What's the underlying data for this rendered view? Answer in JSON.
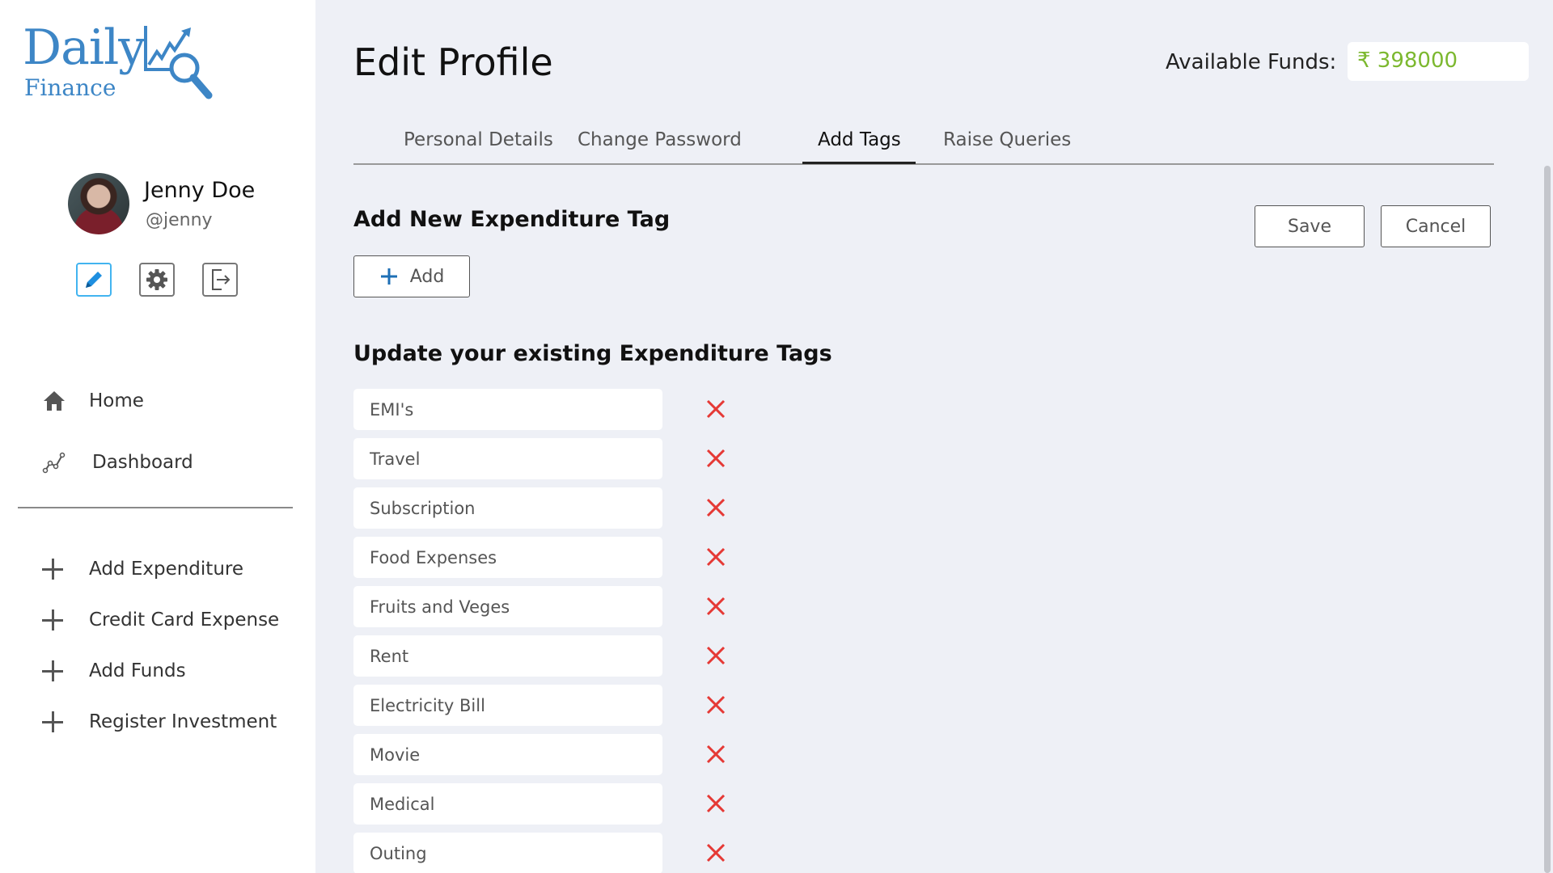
{
  "logo": {
    "line1": "Daily",
    "line2": "Finance"
  },
  "user": {
    "name": "Jenny Doe",
    "handle": "@jenny"
  },
  "nav": [
    {
      "label": "Home",
      "icon": "home-icon"
    },
    {
      "label": "Dashboard",
      "icon": "chart-line-icon"
    }
  ],
  "quick_actions": [
    {
      "label": "Add Expenditure"
    },
    {
      "label": "Credit Card Expense"
    },
    {
      "label": "Add Funds"
    },
    {
      "label": "Register Investment"
    }
  ],
  "header": {
    "title": "Edit Profile",
    "funds_label": "Available Funds:",
    "funds_value": "₹ 398000"
  },
  "tabs": [
    {
      "label": "Personal Details"
    },
    {
      "label": "Change Password"
    },
    {
      "label": "Add Tags",
      "active": true
    },
    {
      "label": "Raise Queries"
    }
  ],
  "add_section": {
    "title": "Add New Expenditure Tag",
    "add_label": "Add",
    "save_label": "Save",
    "cancel_label": "Cancel"
  },
  "update_section": {
    "title": "Update your existing Expenditure Tags"
  },
  "tags": [
    "EMI's",
    "Travel",
    "Subscription",
    "Food Expenses",
    "Fruits and Veges",
    "Rent",
    "Electricity Bill",
    "Movie",
    "Medical",
    "Outing"
  ],
  "colors": {
    "accent": "#3d86c6",
    "funds": "#7cb82f",
    "delete": "#e53935",
    "edit_active": "#42b4f0"
  }
}
